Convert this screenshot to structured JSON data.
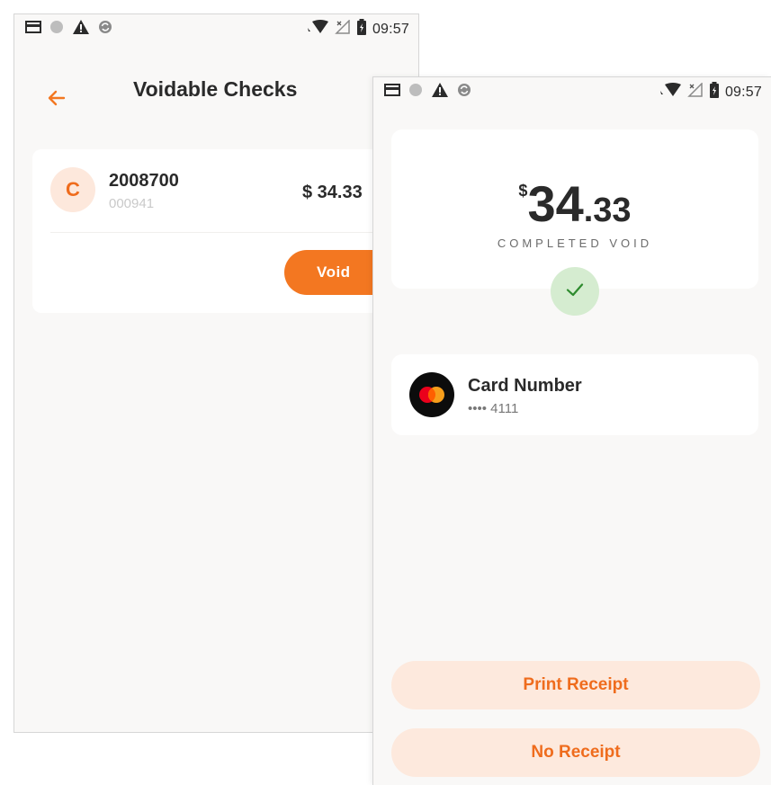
{
  "left_screen": {
    "status_bar": {
      "time": "09:57",
      "left_icons": [
        "card-icon",
        "circle-icon",
        "warning-icon",
        "sync-icon"
      ],
      "right_icons": [
        "wifi-icon",
        "no-signal-icon",
        "battery-icon"
      ]
    },
    "header": {
      "back_icon": "arrow-left-icon",
      "title": "Voidable Checks"
    },
    "checks": [
      {
        "initial": "C",
        "number": "2008700",
        "sub_number": "000941",
        "amount": "$ 34.33",
        "action_label": "Void"
      }
    ]
  },
  "right_screen": {
    "status_bar": {
      "time": "09:57",
      "left_icons": [
        "card-icon",
        "circle-icon",
        "warning-icon",
        "sync-icon"
      ],
      "right_icons": [
        "wifi-icon",
        "no-signal-icon",
        "battery-icon"
      ]
    },
    "amount": {
      "currency": "$",
      "whole": "34",
      "cents": ".33",
      "status": "COMPLETED VOID"
    },
    "success_icon": "check-icon",
    "card": {
      "brand_icon": "mastercard-icon",
      "title": "Card Number",
      "masked_number": "•••• 4111"
    },
    "buttons": {
      "print_receipt": "Print Receipt",
      "no_receipt": "No Receipt"
    }
  },
  "colors": {
    "accent": "#f37721",
    "accent_light": "#fde9dd",
    "success_bg": "#d5ecd0",
    "success_check": "#2e8b2e",
    "background": "#f9f8f7"
  }
}
